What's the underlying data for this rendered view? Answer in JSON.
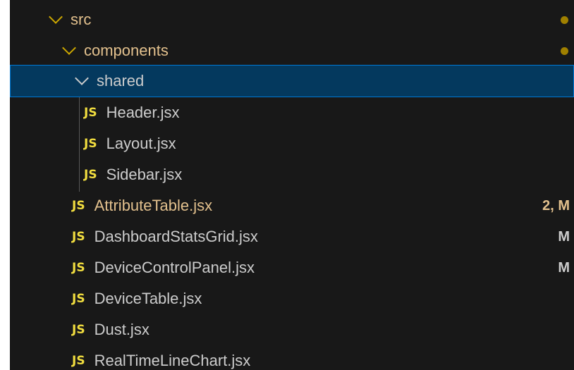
{
  "tree": {
    "src": {
      "label": "src"
    },
    "components": {
      "label": "components"
    },
    "shared": {
      "label": "shared",
      "files": [
        "Header.jsx",
        "Layout.jsx",
        "Sidebar.jsx"
      ]
    },
    "files": [
      {
        "name": "AttributeTable.jsx",
        "badge": "2, M"
      },
      {
        "name": "DashboardStatsGrid.jsx",
        "badge": "M"
      },
      {
        "name": "DeviceControlPanel.jsx",
        "badge": "M"
      },
      {
        "name": "DeviceTable.jsx",
        "badge": ""
      },
      {
        "name": "Dust.jsx",
        "badge": ""
      },
      {
        "name": "RealTimeLineChart.jsx",
        "badge": ""
      }
    ],
    "file_icon_text": "JS"
  },
  "colors": {
    "background": "#181818",
    "selection": "#04395e",
    "modified_text": "#e2c08d",
    "js_icon": "#f1dd3f"
  }
}
